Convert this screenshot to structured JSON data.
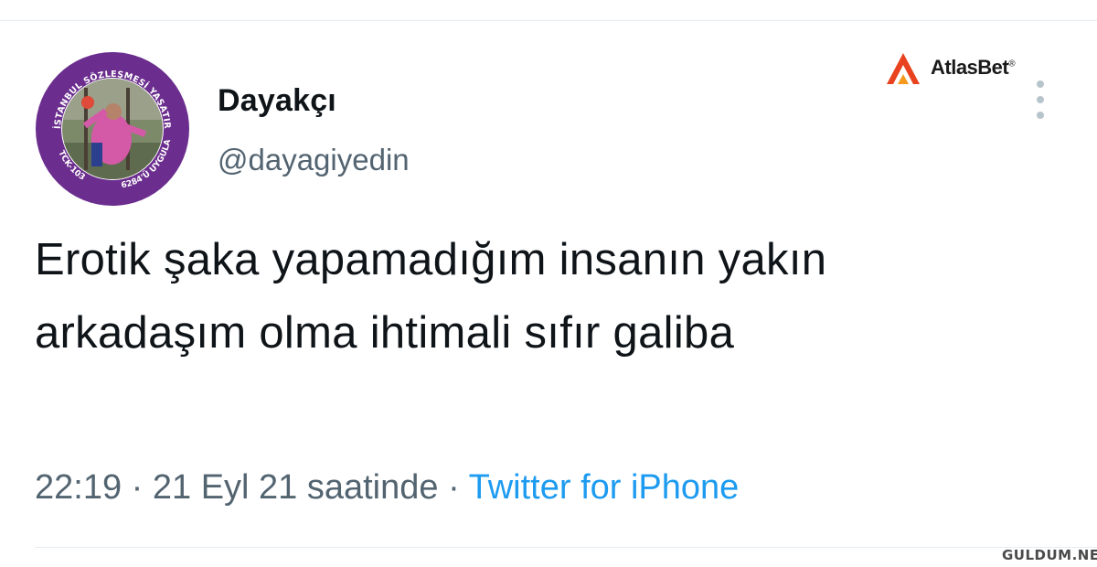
{
  "tweet": {
    "display_name": "Dayakçı",
    "handle": "@dayagiyedin",
    "text": "Erotik şaka yapamadığım insanın yakın arkadaşım olma ihtimali sıfır galiba",
    "timestamp": "22:19 · 21 Eyl 21 saatinde ·",
    "source": "Twitter for iPhone",
    "avatar_ring_text_top": "İSTANBUL SÖZLEŞMESİ YAŞATIR",
    "avatar_ring_text_bottom_left": "TCK-103",
    "avatar_ring_text_bottom_right": "6284'Ü UYGULA"
  },
  "brand": {
    "name": "AtlasBet",
    "registered": "®",
    "accent_color": "#e8421f"
  },
  "watermark": "GULDUM.NET",
  "colors": {
    "text": "#0f1419",
    "secondary": "#536471",
    "link": "#1d9bf0",
    "avatar_ring": "#6b2d8e"
  },
  "icons": {
    "more": "more-vertical-icon",
    "brand": "atlasbet-logo-icon"
  }
}
